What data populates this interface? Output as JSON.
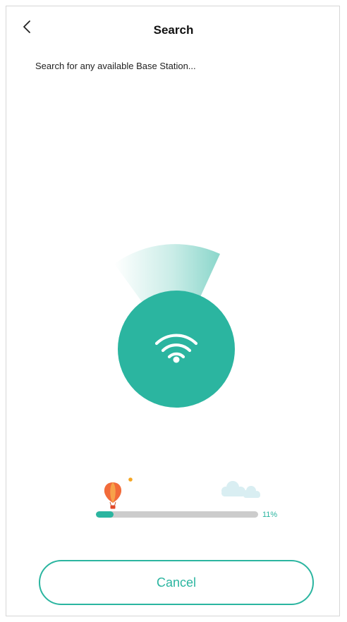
{
  "header": {
    "title": "Search",
    "back_icon": "chevron-left-icon"
  },
  "status": {
    "message": "Search for any available Base Station..."
  },
  "radar": {
    "icon": "wifi-icon",
    "accent_color": "#2bb5a0"
  },
  "progress": {
    "value": 0.11,
    "label": "11%",
    "decorations": [
      "hot-air-balloon-icon",
      "cloud-icon"
    ]
  },
  "actions": {
    "cancel_label": "Cancel"
  },
  "colors": {
    "accent": "#2bb5a0",
    "track": "#cccccc",
    "balloon": "#f26b3a"
  }
}
